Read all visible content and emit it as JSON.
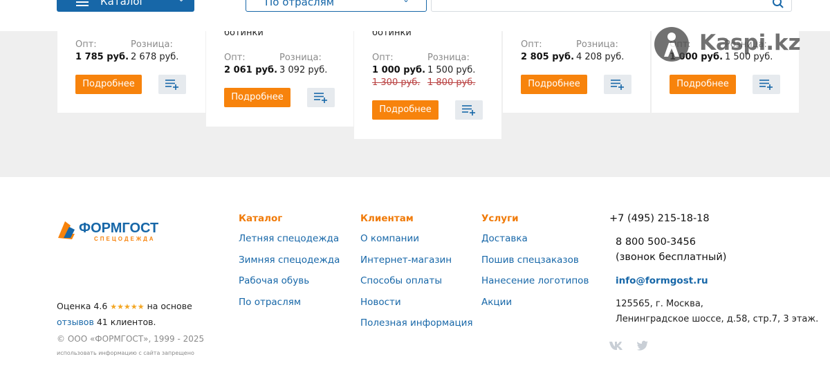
{
  "header": {
    "catalog_label": "Каталог",
    "sector_label": "По отраслям",
    "search_placeholder": ""
  },
  "products": [
    {
      "name": "",
      "opt_label": "Опт:",
      "opt_price": "1 785 руб.",
      "retail_label": "Розница:",
      "retail_price": "2 678 руб.",
      "old_opt": "",
      "old_retail": "",
      "button": "Подробнее"
    },
    {
      "name": "ботинки",
      "opt_label": "Опт:",
      "opt_price": "2 061 руб.",
      "retail_label": "Розница:",
      "retail_price": "3 092 руб.",
      "old_opt": "",
      "old_retail": "",
      "button": "Подробнее"
    },
    {
      "name": "ботинки",
      "opt_label": "Опт:",
      "opt_price": "1 000 руб.",
      "retail_label": "Розница:",
      "retail_price": "1 500 руб.",
      "old_opt": "1 300 руб.",
      "old_retail": "1 800 руб.",
      "button": "Подробнее"
    },
    {
      "name": "",
      "opt_label": "Опт:",
      "opt_price": "2 805 руб.",
      "retail_label": "Розница:",
      "retail_price": "4 208 руб.",
      "old_opt": "",
      "old_retail": "",
      "button": "Подробнее"
    },
    {
      "name": "",
      "opt_label": "Опт:",
      "opt_price": "1 000 руб.",
      "retail_label": "Розница:",
      "retail_price": "1 500 руб.",
      "old_opt": "",
      "old_retail": "",
      "button": "Подробнее"
    }
  ],
  "watermark": {
    "text": "Kaspi.kz"
  },
  "footer": {
    "logo_text": "ФОРМГОСТ",
    "logo_sub": "СПЕЦОДЕЖДА",
    "rating_prefix": "Оценка 4.6",
    "rating_stars": "★★★★★",
    "rating_mid": "на основе",
    "reviews_link": "отзывов",
    "rating_suffix": "41 клиентов.",
    "copyright": "© ООО «ФОРМГОСТ», 1999 - 2025",
    "copy_note": "использовать информацию с сайта запрещено",
    "columns": [
      {
        "title": "Каталог",
        "links": [
          "Летняя спецодежда",
          "Зимняя спецодежда",
          "Рабочая обувь",
          "По отраслям"
        ]
      },
      {
        "title": "Клиентам",
        "links": [
          "О компании",
          "Интернет-магазин",
          "Способы оплаты",
          "Новости",
          "Полезная информация"
        ]
      },
      {
        "title": "Услуги",
        "links": [
          "Доставка",
          "Пошив спецзаказов",
          "Нанесение логотипов",
          "Акции"
        ]
      }
    ],
    "contacts": {
      "phone1": "+7 (495) 215-18-18",
      "phone2": "8 800 500-3456",
      "free_note": "(звонок бесплатный)",
      "email": "info@formgost.ru",
      "address1": "125565, г. Москва,",
      "address2": "Ленинградское шоссе, д.58, стр.7, 3 этаж."
    },
    "social_icons": [
      "vk-icon",
      "twitter-icon"
    ]
  },
  "colors": {
    "brand_blue": "#1767a8",
    "accent_orange": "#f7830c",
    "old_price_red": "#b94141"
  }
}
